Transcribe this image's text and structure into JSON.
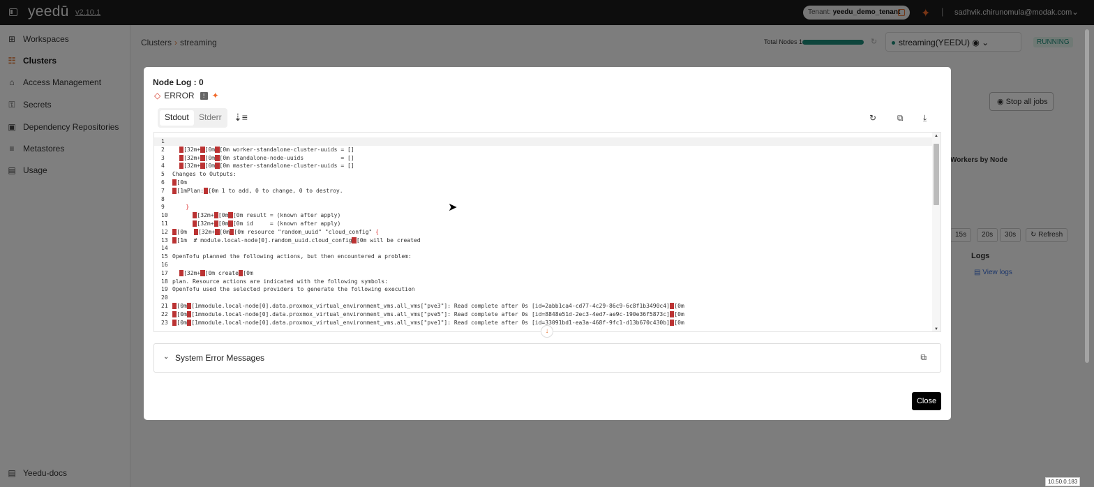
{
  "header": {
    "logo": "yeedū",
    "version": "v2.10.1",
    "tenant_label": "Tenant:",
    "tenant_name": "yeedu_demo_tenant",
    "user_email": "sadhvik.chirunomula@modak.com"
  },
  "sidebar": {
    "items": [
      {
        "label": "Workspaces",
        "icon": "workspace-icon"
      },
      {
        "label": "Clusters",
        "icon": "cluster-icon",
        "active": true
      },
      {
        "label": "Access Management",
        "icon": "access-icon"
      },
      {
        "label": "Secrets",
        "icon": "key-icon"
      },
      {
        "label": "Dependency Repositories",
        "icon": "repository-icon"
      },
      {
        "label": "Metastores",
        "icon": "database-icon"
      },
      {
        "label": "Usage",
        "icon": "usage-icon"
      }
    ],
    "docs": "Yeedu-docs"
  },
  "main": {
    "breadcrumb": [
      "Clusters",
      "streaming"
    ],
    "total_nodes_label": "Total Nodes 1",
    "total_nodes_progress": 1.0,
    "cluster_select": "streaming(YEEDU)",
    "status": "RUNNING",
    "stop_jobs": "Stop all jobs",
    "workers_by_node": "Workers by Node",
    "interval_buttons": [
      "15s",
      "20s",
      "30s"
    ],
    "refresh": "Refresh",
    "logs_header": "Logs",
    "view_logs": "View logs"
  },
  "ip_badge": "10.50.0.183",
  "modal": {
    "title": "Node Log : 0",
    "error_label": "ERROR",
    "tabs": [
      "Stdout",
      "Stderr"
    ],
    "log_lines": [
      {
        "n": "1",
        "t": ""
      },
      {
        "n": "2",
        "t": "  ␛[32m+␛[0m␛[0m worker-standalone-cluster-uuids = []"
      },
      {
        "n": "3",
        "t": "  ␛[32m+␛[0m␛[0m standalone-node-uuids           = []"
      },
      {
        "n": "4",
        "t": "  ␛[32m+␛[0m␛[0m master-standalone-cluster-uuids = []"
      },
      {
        "n": "5",
        "t": "Changes to Outputs:"
      },
      {
        "n": "6",
        "t": "␛[0m"
      },
      {
        "n": "7",
        "t": "␛[1mPlan:␛[0m 1 to add, 0 to change, 0 to destroy."
      },
      {
        "n": "8",
        "t": ""
      },
      {
        "n": "9",
        "t": "    }"
      },
      {
        "n": "10",
        "t": "      ␛[32m+␛[0m␛[0m result = (known after apply)"
      },
      {
        "n": "11",
        "t": "      ␛[32m+␛[0m␛[0m id     = (known after apply)"
      },
      {
        "n": "12",
        "t": "␛[0m  ␛[32m+␛[0m␛[0m resource \"random_uuid\" \"cloud_config\" {"
      },
      {
        "n": "13",
        "t": "␛[1m  # module.local-node[0].random_uuid.cloud_config␛[0m will be created"
      },
      {
        "n": "14",
        "t": ""
      },
      {
        "n": "15",
        "t": "OpenTofu planned the following actions, but then encountered a problem:"
      },
      {
        "n": "16",
        "t": ""
      },
      {
        "n": "17",
        "t": "  ␛[32m+␛[0m create␛[0m"
      },
      {
        "n": "18",
        "t": "plan. Resource actions are indicated with the following symbols:"
      },
      {
        "n": "19",
        "t": "OpenTofu used the selected providers to generate the following execution"
      },
      {
        "n": "20",
        "t": ""
      },
      {
        "n": "21",
        "t": "␛[0m␛[1mmodule.local-node[0].data.proxmox_virtual_environment_vms.all_vms[\"pve3\"]: Read complete after 0s [id=2abb1ca4-cd77-4c29-86c9-6c8f1b3490c4]␛[0m"
      },
      {
        "n": "22",
        "t": "␛[0m␛[1mmodule.local-node[0].data.proxmox_virtual_environment_vms.all_vms[\"pve5\"]: Read complete after 0s [id=8848e51d-2ec3-4ed7-ae9c-190e36f5873c]␛[0m"
      },
      {
        "n": "23",
        "t": "␛[0m␛[1mmodule.local-node[0].data.proxmox_virtual_environment_vms.all_vms[\"pve1\"]: Read complete after 0s [id=33091bd1-ea3a-468f-9fc1-d13b670c430b]␛[0m"
      }
    ],
    "system_error_messages": "System Error Messages",
    "close": "Close"
  }
}
